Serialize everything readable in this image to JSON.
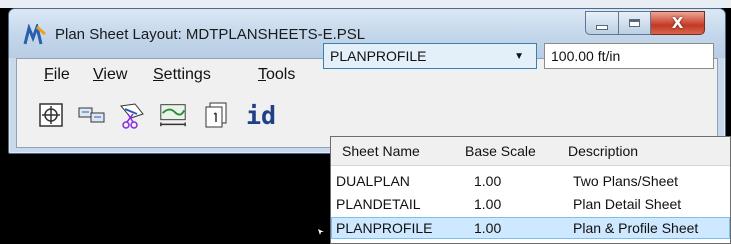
{
  "window": {
    "title": "Plan Sheet Layout: MDTPLANSHEETS-E.PSL",
    "close_glyph": "X"
  },
  "menubar": {
    "items": [
      {
        "mnemonic": "F",
        "rest": "ile"
      },
      {
        "mnemonic": "V",
        "rest": "iew"
      },
      {
        "mnemonic": "S",
        "rest": "ettings"
      },
      {
        "mnemonic": "T",
        "rest": "ools"
      }
    ]
  },
  "toolbar": {
    "icons": [
      "place-sheet-icon",
      "sheet-pair-icon",
      "clip-cut-icon",
      "profile-sheet-icon",
      "sheet-number-icon",
      "id-icon"
    ],
    "id_label": "id",
    "sheet_type_selected": "PLANPROFILE",
    "scale_value": "100.00 ft/in"
  },
  "dropdown": {
    "headers": [
      "Sheet Name",
      "Base Scale",
      "Description"
    ],
    "rows": [
      {
        "name": "DUALPLAN",
        "scale": "1.00",
        "description": "Two Plans/Sheet"
      },
      {
        "name": "PLANDETAIL",
        "scale": "1.00",
        "description": "Plan Detail Sheet"
      },
      {
        "name": "PLANPROFILE",
        "scale": "1.00",
        "description": "Plan & Profile Sheet"
      }
    ],
    "selected_index": 2
  },
  "colors": {
    "selection_bg": "#cde8ff",
    "combo_bg": "#e3f0fa",
    "close_button": "#c03a26"
  }
}
